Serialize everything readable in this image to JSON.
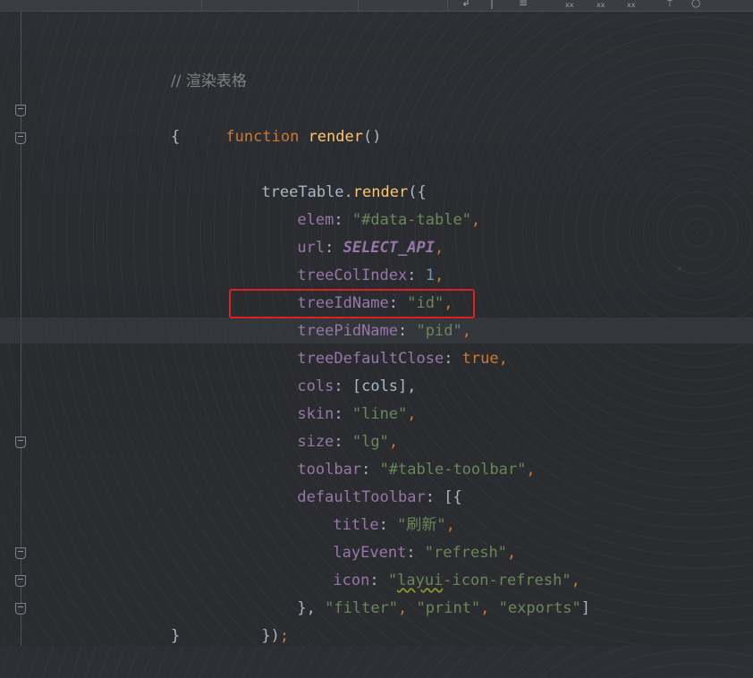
{
  "editor": {
    "comment": "// 渲染表格",
    "line_function": {
      "keyword": "function",
      "name": "render",
      "tail": "()"
    },
    "line_open_brace": "{",
    "line_call": {
      "object": "treeTable.",
      "method": "render",
      "tail": "({"
    },
    "line_elem": {
      "key": "elem",
      "sep": ": ",
      "value": "\"#data-table\"",
      "end": ","
    },
    "line_url": {
      "key": "url",
      "sep": ": ",
      "value": "SELECT_API",
      "end": ","
    },
    "line_treeColIndex": {
      "key": "treeColIndex",
      "sep": ": ",
      "value": "1",
      "end": ","
    },
    "line_treeIdName": {
      "key": "treeIdName",
      "sep": ": ",
      "value": "\"id\"",
      "end": ","
    },
    "line_treePidName": {
      "key": "treePidName",
      "sep": ": ",
      "value": "\"pid\"",
      "end": ","
    },
    "line_treeDefaultClose": {
      "key": "treeDefaultClose",
      "sep": ": ",
      "value": "true",
      "end": ","
    },
    "line_cols": {
      "key": "cols",
      "sep": ": [",
      "value": "cols",
      "end": "],"
    },
    "line_skin": {
      "key": "skin",
      "sep": ": ",
      "value": "\"line\"",
      "end": ","
    },
    "line_size": {
      "key": "size",
      "sep": ": ",
      "value": "\"lg\"",
      "end": ","
    },
    "line_toolbar": {
      "key": "toolbar",
      "sep": ": ",
      "value": "\"#table-toolbar\"",
      "end": ","
    },
    "line_defaultToolbar": {
      "key": "defaultToolbar",
      "sep": ": [{"
    },
    "line_title": {
      "key": "title",
      "sep": ": ",
      "value": "\"刷新\"",
      "end": ","
    },
    "line_layEvent": {
      "key": "layEvent",
      "sep": ": ",
      "value": "\"refresh\"",
      "end": ","
    },
    "line_icon": {
      "key": "icon",
      "sep": ": ",
      "value_open": "\"",
      "value_squiggle": "layui",
      "value_rest": "-icon-refresh\"",
      "end": ","
    },
    "line_array_close": {
      "brace": "}, ",
      "filter": "\"filter\"",
      "comma1": ", ",
      "print": "\"print\"",
      "comma2": ", ",
      "exports": "\"exports\"",
      "bracket": "]"
    },
    "line_call_close": {
      "paren": "})",
      "semi": ";"
    },
    "line_close_brace": "}"
  },
  "toolbar_icons": [
    "arrow-icon",
    "pause-icon",
    "list-icon",
    "xx-icon",
    "xx-icon",
    "xx-icon",
    "upload-icon",
    "refresh-icon"
  ],
  "colors": {
    "keyword": "#cc7832",
    "function": "#ffc66d",
    "property": "#9876aa",
    "string": "#6a8759",
    "number": "#6897bb",
    "plain": "#a9b7c6",
    "comment": "#808080",
    "highlight_border": "#e02020"
  }
}
